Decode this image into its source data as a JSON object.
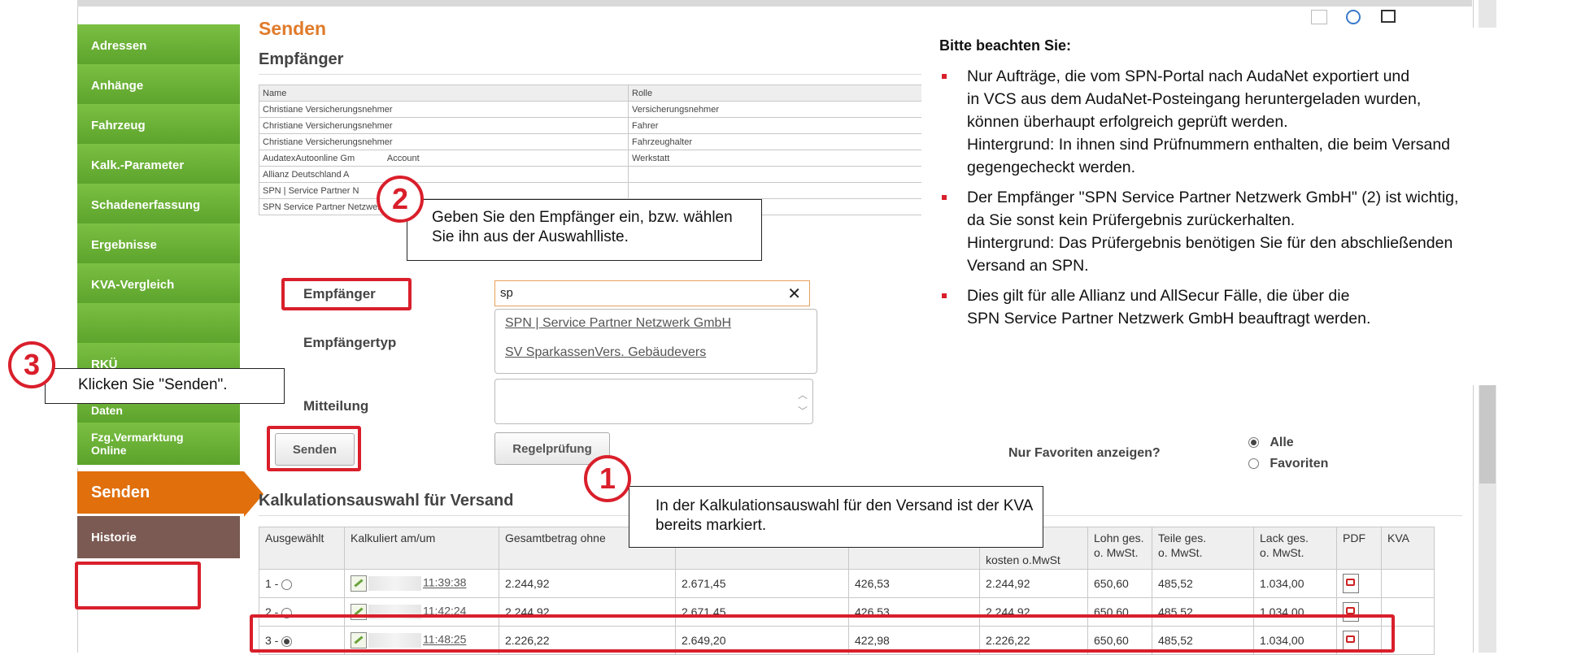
{
  "page": {
    "title": "Senden"
  },
  "sidebar": {
    "items": [
      {
        "label": "Adressen"
      },
      {
        "label": "Anhänge"
      },
      {
        "label": "Fahrzeug"
      },
      {
        "label": "Kalk.-Parameter"
      },
      {
        "label": "Schadenerfassung"
      },
      {
        "label": "Ergebnisse"
      },
      {
        "label": "KVA-Vergleich"
      },
      {
        "label": ""
      },
      {
        "label": "RKÜ"
      },
      {
        "label": "Fzg.Vermarktung Daten"
      },
      {
        "label": "Fzg.Vermarktung Online"
      },
      {
        "label": "Senden"
      },
      {
        "label": "Historie"
      }
    ]
  },
  "recipients": {
    "heading": "Empfänger",
    "columns": [
      "Name",
      "Rolle"
    ],
    "rows": [
      [
        "Christiane Versicherungsnehmer",
        "Versicherungsnehmer"
      ],
      [
        "Christiane Versicherungsnehmer",
        "Fahrer"
      ],
      [
        "Christiane Versicherungsnehmer",
        "Fahrzeughalter"
      ],
      [
        "AudatexAutoonline Gm",
        "Account",
        "Werkstatt"
      ],
      [
        "Allianz Deutschland A",
        ""
      ],
      [
        "SPN | Service Partner N",
        ""
      ],
      [
        "SPN Service Partner Netzwer",
        ""
      ]
    ]
  },
  "form": {
    "recipient_label": "Empfänger",
    "recipient_value": "sp",
    "clear_icon": "close-icon",
    "recipient_type_label": "Empfängertyp",
    "suggestions": [
      "SPN | Service Partner Netzwerk GmbH",
      "SV SparkassenVers. Gebäudevers"
    ],
    "message_label": "Mitteilung",
    "send_button": "Senden",
    "rule_check_button": "Regelprüfung",
    "favorites_question": "Nur Favoriten anzeigen?",
    "radio_all": "Alle",
    "radio_favorites": "Favoriten"
  },
  "calc_section": {
    "heading": "Kalkulationsauswahl für Versand",
    "columns": {
      "selected": "Ausgewählt",
      "calculated": "Kalkuliert am/um",
      "total": "Gesamtbetrag ohne",
      "repair": "kosten o.MwSt",
      "labor": [
        "Lohn ges.",
        "o. MwSt."
      ],
      "parts": [
        "Teile ges.",
        "o. MwSt."
      ],
      "paint": [
        "Lack ges.",
        "o. MwSt."
      ],
      "pdf": "PDF",
      "kva": "KVA"
    },
    "rows": [
      {
        "sel": "1 -",
        "checked": false,
        "time": "11:39:38",
        "total": "2.244,92",
        "gross": "2.671,45",
        "tax": "426,53",
        "repair": "2.244,92",
        "labor": "650,60",
        "parts": "485,52",
        "paint": "1.034,00"
      },
      {
        "sel": "2 -",
        "checked": false,
        "time": "11:42:24",
        "total": "2.244,92",
        "gross": "2.671,45",
        "tax": "426,53",
        "repair": "2.244,92",
        "labor": "650,60",
        "parts": "485,52",
        "paint": "1.034,00"
      },
      {
        "sel": "3 -",
        "checked": true,
        "time": "11:48:25",
        "total": "2.226,22",
        "gross": "2.649,20",
        "tax": "422,98",
        "repair": "2.226,22",
        "labor": "650,60",
        "parts": "485,52",
        "paint": "1.034,00"
      }
    ]
  },
  "callouts": {
    "c1_num": "1",
    "c1_text": "In der Kalkulationsauswahl für den Versand ist der KVA bereits markiert.",
    "c2_num": "2",
    "c2_text": "Geben Sie den Empfänger ein, bzw. wählen Sie ihn aus der Auswahlliste.",
    "c3_num": "3",
    "c3_text": "Klicken Sie \"Senden\"."
  },
  "note": {
    "title": "Bitte beachten Sie:",
    "items": [
      [
        "Nur Aufträge, die vom SPN-Portal nach AudaNet exportiert und",
        "in VCS aus dem AudaNet-Posteingang heruntergeladen wurden,",
        "können überhaupt erfolgreich geprüft werden.",
        "Hintergrund: In ihnen sind Prüfnummern enthalten, die beim Versand",
        "gegengecheckt werden."
      ],
      [
        "Der Empfänger \"SPN Service Partner Netzwerk GmbH\" (2) ist wichtig,",
        "da Sie sonst kein Prüfergebnis zurückerhalten.",
        "Hintergrund: Das Prüfergebnis benötigen Sie für den abschließenden",
        "Versand an SPN."
      ],
      [
        "Dies gilt für alle Allianz und AllSecur Fälle, die über die",
        "SPN Service Partner Netzwerk GmbH beauftragt werden."
      ]
    ]
  },
  "colors": {
    "accent": "#e06f0c",
    "highlight": "#d91f2b",
    "nav": "#6cb33f"
  }
}
